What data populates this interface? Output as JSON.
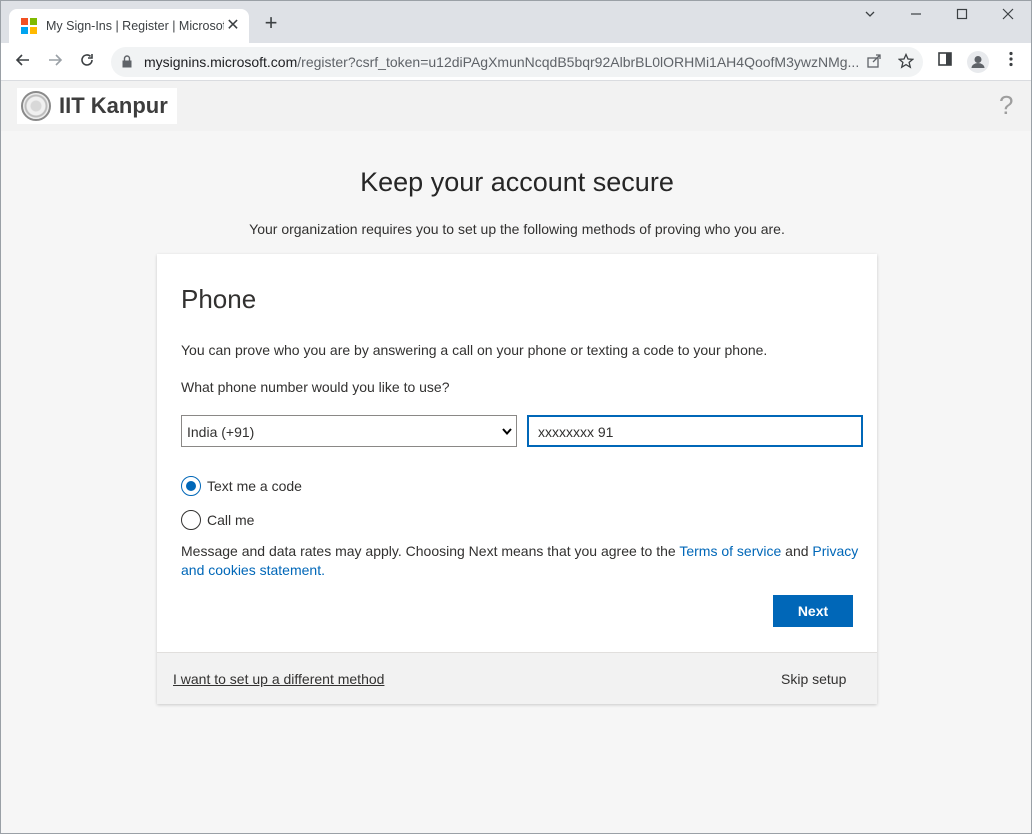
{
  "browser": {
    "tab_title": "My Sign-Ins | Register | Microsoft",
    "tab_close": "✕",
    "new_tab": "+",
    "url_host": "mysignins.microsoft.com",
    "url_path": "/register?csrf_token=u12diPAgXmunNcqdB5bqr92AlbrBL0lORHMi1AH4QoofM3ywzNMg...",
    "ms_logo_colors": [
      "#f25022",
      "#7fba00",
      "#00a4ef",
      "#ffb900"
    ]
  },
  "header": {
    "org_name": "IIT Kanpur",
    "help": "?"
  },
  "main": {
    "title": "Keep your account secure",
    "subtitle": "Your organization requires you to set up the following methods of proving who you are."
  },
  "card": {
    "title": "Phone",
    "description": "You can prove who you are by answering a call on your phone or texting a code to your phone.",
    "question": "What phone number would you like to use?",
    "country_value": "India (+91)",
    "phone_value": "xxxxxxxx 91",
    "option_text": "Text me a code",
    "option_call": "Call me",
    "selected_option": "Text me a code",
    "disclaimer_prefix": "Message and data rates may apply. Choosing Next means that you agree to the",
    "terms_link": "Terms of service",
    "and": "and",
    "privacy_link": "Privacy and cookies statement.",
    "next_label": "Next",
    "different_method": "I want to set up a different method",
    "skip_setup": "Skip setup"
  },
  "colors": {
    "accent": "#0067b8",
    "page_bg": "#f6f6f6"
  }
}
